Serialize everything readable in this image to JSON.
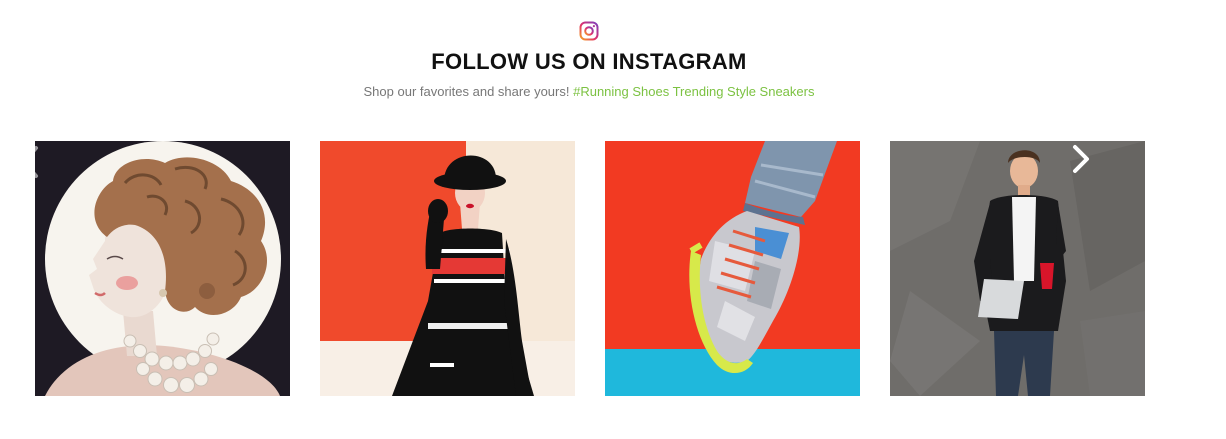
{
  "section": {
    "icon": "instagram-icon",
    "title": "FOLLOW US ON INSTAGRAM",
    "subtitle_text": "Shop our favorites and share yours!",
    "subtitle_tags": "#Running Shoes Trending Style Sneakers",
    "tag_color": "#7cc242"
  },
  "carousel": {
    "prev_icon": "chevron-left-icon",
    "next_icon": "chevron-right-icon",
    "posts": [
      {
        "image": "curly-updo-portrait-photo"
      },
      {
        "image": "black-hat-dress-photo"
      },
      {
        "image": "silver-sneaker-photo"
      },
      {
        "image": "man-with-laptop-photo"
      }
    ]
  }
}
